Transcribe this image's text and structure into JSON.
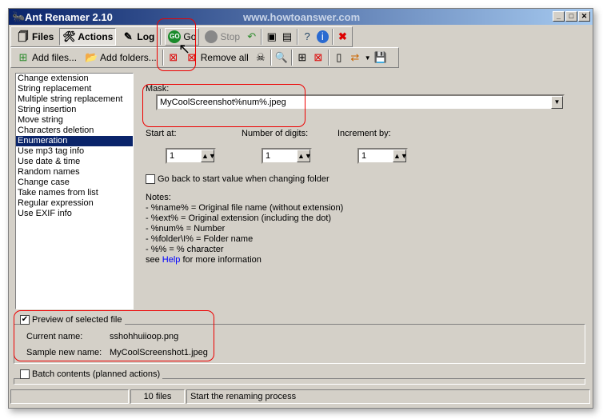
{
  "window": {
    "title": "Ant Renamer 2.10",
    "watermark": "www.howtoanswer.com"
  },
  "toolbar1": {
    "files": "Files",
    "actions": "Actions",
    "log": "Log",
    "go": "Go",
    "stop": "Stop"
  },
  "toolbar2": {
    "add_files": "Add files...",
    "add_folders": "Add folders...",
    "remove_all": "Remove all"
  },
  "actions_list": {
    "selected": "Enumeration",
    "items": [
      "Change extension",
      "String replacement",
      "Multiple string replacement",
      "String insertion",
      "Move string",
      "Characters deletion",
      "Enumeration",
      "Use mp3 tag info",
      "Use date & time",
      "Random names",
      "Change case",
      "Take names from list",
      "Regular expression",
      "Use EXIF info"
    ]
  },
  "enumeration": {
    "mask_label": "Mask:",
    "mask_value": "MyCoolScreenshot%num%.jpeg",
    "start_label": "Start at:",
    "start_value": "1",
    "digits_label": "Number of digits:",
    "digits_value": "1",
    "increment_label": "Increment by:",
    "increment_value": "1",
    "go_back_label": "Go back to start value when changing folder",
    "go_back_checked": false,
    "notes_title": "Notes:",
    "notes": [
      "- %name% = Original file name (without extension)",
      "- %ext% = Original extension (including the dot)",
      "- %num% = Number",
      "- %folder\\I% = Folder name",
      "- %% = % character"
    ],
    "see": "see ",
    "help_link": "Help",
    "more": " for more information"
  },
  "preview": {
    "label": "Preview of selected file",
    "checked": true,
    "current_label": "Current name:",
    "current_value": "sshohhuiioop.png",
    "sample_label": "Sample new name:",
    "sample_value": "MyCoolScreenshot1.jpeg"
  },
  "batch": {
    "label": "Batch contents (planned actions)",
    "checked": false
  },
  "statusbar": {
    "panel1": "",
    "files": "10 files",
    "message": "Start the renaming process"
  },
  "colors": {
    "highlight": "#e00000",
    "selection": "#0a246a",
    "face": "#d4d0c8"
  }
}
